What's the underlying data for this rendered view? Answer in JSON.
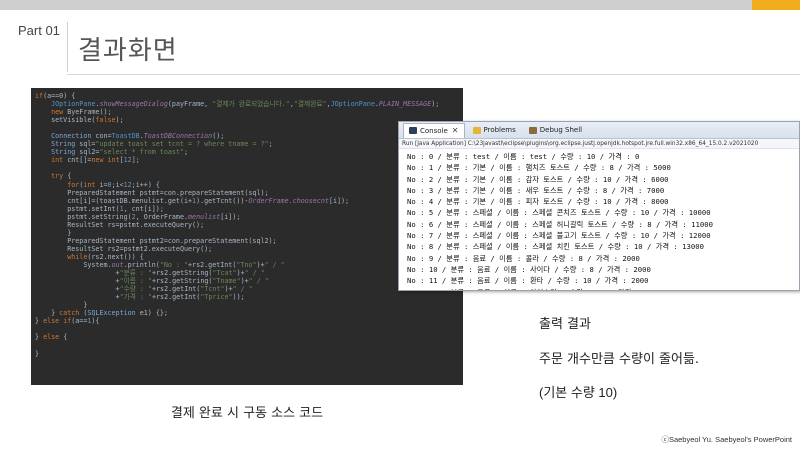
{
  "header": {
    "part_label": "Part 01",
    "title": "결과화면"
  },
  "code": {
    "lines": [
      [
        {
          "c": "kw",
          "t": "if"
        },
        {
          "c": "fn",
          "t": "(a==0) {"
        }
      ],
      [
        {
          "c": "fn",
          "t": "    "
        },
        {
          "c": "cls",
          "t": "JOptionPane"
        },
        {
          "c": "fn",
          "t": "."
        },
        {
          "c": "it",
          "t": "showMessageDialog"
        },
        {
          "c": "fn",
          "t": "(payFrame, "
        },
        {
          "c": "str",
          "t": "\"결제가 완료되었습니다.\""
        },
        {
          "c": "fn",
          "t": ","
        },
        {
          "c": "str",
          "t": "\"결제완료\""
        },
        {
          "c": "fn",
          "t": ","
        },
        {
          "c": "cls",
          "t": "JOptionPane"
        },
        {
          "c": "fn",
          "t": "."
        },
        {
          "c": "it",
          "t": "PLAIN_MESSAGE"
        },
        {
          "c": "fn",
          "t": ");"
        }
      ],
      [
        {
          "c": "fn",
          "t": "    "
        },
        {
          "c": "kw",
          "t": "new"
        },
        {
          "c": "fn",
          "t": " ByeFrame();"
        }
      ],
      [
        {
          "c": "fn",
          "t": "    setVisible("
        },
        {
          "c": "kw",
          "t": "false"
        },
        {
          "c": "fn",
          "t": ");"
        }
      ],
      [
        {
          "c": "fn",
          "t": ""
        }
      ],
      [
        {
          "c": "fn",
          "t": "    "
        },
        {
          "c": "typ",
          "t": "Connection"
        },
        {
          "c": "fn",
          "t": " con="
        },
        {
          "c": "cls",
          "t": "ToastDB"
        },
        {
          "c": "fn",
          "t": "."
        },
        {
          "c": "it",
          "t": "ToastDBConnection"
        },
        {
          "c": "fn",
          "t": "();"
        }
      ],
      [
        {
          "c": "fn",
          "t": "    "
        },
        {
          "c": "typ",
          "t": "String"
        },
        {
          "c": "fn",
          "t": " sql="
        },
        {
          "c": "str",
          "t": "\"update toast set tcnt = ? where tname = ?\""
        },
        {
          "c": "fn",
          "t": ";"
        }
      ],
      [
        {
          "c": "fn",
          "t": "    "
        },
        {
          "c": "typ",
          "t": "String"
        },
        {
          "c": "fn",
          "t": " sql2="
        },
        {
          "c": "str",
          "t": "\"select * from toast\""
        },
        {
          "c": "fn",
          "t": ";"
        }
      ],
      [
        {
          "c": "fn",
          "t": "    "
        },
        {
          "c": "kw",
          "t": "int"
        },
        {
          "c": "fn",
          "t": " cnt[]="
        },
        {
          "c": "kw",
          "t": "new"
        },
        {
          "c": "fn",
          "t": " "
        },
        {
          "c": "kw",
          "t": "int"
        },
        {
          "c": "fn",
          "t": "["
        },
        {
          "c": "num",
          "t": "12"
        },
        {
          "c": "fn",
          "t": "];"
        }
      ],
      [
        {
          "c": "fn",
          "t": ""
        }
      ],
      [
        {
          "c": "fn",
          "t": "    "
        },
        {
          "c": "kw",
          "t": "try"
        },
        {
          "c": "fn",
          "t": " {"
        }
      ],
      [
        {
          "c": "fn",
          "t": "        "
        },
        {
          "c": "kw",
          "t": "for"
        },
        {
          "c": "fn",
          "t": "("
        },
        {
          "c": "kw",
          "t": "int"
        },
        {
          "c": "fn",
          "t": " i="
        },
        {
          "c": "num",
          "t": "0"
        },
        {
          "c": "fn",
          "t": ";i<"
        },
        {
          "c": "num",
          "t": "12"
        },
        {
          "c": "fn",
          "t": ";i++) {"
        }
      ],
      [
        {
          "c": "fn",
          "t": "        PreparedStatement pstmt=con.prepareStatement(sql);"
        }
      ],
      [
        {
          "c": "fn",
          "t": "        cnt[i]=(toastDB.menulist.get(i+"
        },
        {
          "c": "num",
          "t": "1"
        },
        {
          "c": "fn",
          "t": ").getTcnt())-"
        },
        {
          "c": "it",
          "t": "OrderFrame.choosecnt"
        },
        {
          "c": "fn",
          "t": "[i]);"
        }
      ],
      [
        {
          "c": "fn",
          "t": "        pstmt.setInt("
        },
        {
          "c": "num",
          "t": "1"
        },
        {
          "c": "fn",
          "t": ", cnt[i]);"
        }
      ],
      [
        {
          "c": "fn",
          "t": "        pstmt.setString("
        },
        {
          "c": "num",
          "t": "2"
        },
        {
          "c": "fn",
          "t": ", OrderFrame."
        },
        {
          "c": "it",
          "t": "menulist"
        },
        {
          "c": "fn",
          "t": "[i]);"
        }
      ],
      [
        {
          "c": "fn",
          "t": "        ResultSet rs=pstmt.executeQuery();"
        }
      ],
      [
        {
          "c": "fn",
          "t": "        }"
        }
      ],
      [
        {
          "c": "fn",
          "t": "        PreparedStatement pstmt2=con.prepareStatement(sql2);"
        }
      ],
      [
        {
          "c": "fn",
          "t": "        ResultSet rs2=pstmt2.executeQuery();"
        }
      ],
      [
        {
          "c": "fn",
          "t": "        "
        },
        {
          "c": "kw",
          "t": "while"
        },
        {
          "c": "fn",
          "t": "(rs2.next()) {"
        }
      ],
      [
        {
          "c": "fn",
          "t": "            System."
        },
        {
          "c": "it",
          "t": "out"
        },
        {
          "c": "fn",
          "t": ".println("
        },
        {
          "c": "str",
          "t": "\"No : \""
        },
        {
          "c": "fn",
          "t": "+rs2.getInt("
        },
        {
          "c": "str",
          "t": "\"Tno\""
        },
        {
          "c": "fn",
          "t": ")+"
        },
        {
          "c": "str",
          "t": "\" / \""
        }
      ],
      [
        {
          "c": "fn",
          "t": "                    +"
        },
        {
          "c": "str",
          "t": "\"분류 : \""
        },
        {
          "c": "fn",
          "t": "+rs2.getString("
        },
        {
          "c": "str",
          "t": "\"Tcat\""
        },
        {
          "c": "fn",
          "t": ")+"
        },
        {
          "c": "str",
          "t": "\" / \""
        }
      ],
      [
        {
          "c": "fn",
          "t": "                    +"
        },
        {
          "c": "str",
          "t": "\"이름 : \""
        },
        {
          "c": "fn",
          "t": "+rs2.getString("
        },
        {
          "c": "str",
          "t": "\"Tname\""
        },
        {
          "c": "fn",
          "t": ")+"
        },
        {
          "c": "str",
          "t": "\" / \""
        }
      ],
      [
        {
          "c": "fn",
          "t": "                    +"
        },
        {
          "c": "str",
          "t": "\"수량 : \""
        },
        {
          "c": "fn",
          "t": "+rs2.getInt("
        },
        {
          "c": "str",
          "t": "\"Tcnt\""
        },
        {
          "c": "fn",
          "t": ")+"
        },
        {
          "c": "str",
          "t": "\" / \""
        }
      ],
      [
        {
          "c": "fn",
          "t": "                    +"
        },
        {
          "c": "str",
          "t": "\"가격 : \""
        },
        {
          "c": "fn",
          "t": "+rs2.getInt("
        },
        {
          "c": "str",
          "t": "\"Tprice\""
        },
        {
          "c": "fn",
          "t": "));"
        }
      ],
      [
        {
          "c": "fn",
          "t": "            }"
        }
      ],
      [
        {
          "c": "fn",
          "t": "    } "
        },
        {
          "c": "kw",
          "t": "catch"
        },
        {
          "c": "fn",
          "t": " ("
        },
        {
          "c": "typ",
          "t": "SQLException"
        },
        {
          "c": "fn",
          "t": " e1) {};"
        }
      ],
      [
        {
          "c": "fn",
          "t": "} "
        },
        {
          "c": "kw",
          "t": "else if"
        },
        {
          "c": "fn",
          "t": "(a=="
        },
        {
          "c": "num",
          "t": "1"
        },
        {
          "c": "fn",
          "t": "){"
        }
      ],
      [
        {
          "c": "fn",
          "t": ""
        }
      ],
      [
        {
          "c": "fn",
          "t": "} "
        },
        {
          "c": "kw",
          "t": "else"
        },
        {
          "c": "fn",
          "t": " {"
        }
      ],
      [
        {
          "c": "fn",
          "t": ""
        }
      ],
      [
        {
          "c": "fn",
          "t": "}"
        }
      ]
    ]
  },
  "console": {
    "tabs": {
      "console": "Console",
      "problems": "Problems",
      "debug": "Debug Shell",
      "close": "✕"
    },
    "header": "Run [Java Application] C:\\23javastl\\eclipse\\plugins\\org.eclipse.justj.openjdk.hotspot.jre.full.win32.x86_64_15.0.2.v2021020",
    "lines": [
      "No : 0 / 분류 : test / 이름 : test / 수량 : 10 / 가격 : 0",
      "No : 1 / 분류 : 기본 / 이름 : 햄치즈 토스트 / 수량 : 8 / 가격 : 5000",
      "No : 2 / 분류 : 기본 / 이름 : 감자 토스트 / 수량 : 10 / 가격 : 6000",
      "No : 3 / 분류 : 기본 / 이름 : 새우 토스트 / 수량 : 8 / 가격 : 7000",
      "No : 4 / 분류 : 기본 / 이름 : 피자 토스트 / 수량 : 10 / 가격 : 8000",
      "No : 5 / 분류 : 스페셜 / 이름 : 스페셜 콘치즈 토스트 / 수량 : 10 / 가격 : 10000",
      "No : 6 / 분류 : 스페셜 / 이름 : 스페셜 허니갈릭 토스트 / 수량 : 8 / 가격 : 11000",
      "No : 7 / 분류 : 스페셜 / 이름 : 스페셜 불고기 토스트 / 수량 : 10 / 가격 : 12000",
      "No : 8 / 분류 : 스페셜 / 이름 : 스페셜 치킨 토스트 / 수량 : 10 / 가격 : 13000",
      "No : 9 / 분류 : 음료 / 이름 : 콜라 / 수량 : 8 / 가격 : 2000",
      "No : 10 / 분류 : 음료 / 이름 : 사이다 / 수량 : 8 / 가격 : 2000",
      "No : 11 / 분류 : 음료 / 이름 : 환타 / 수량 : 10 / 가격 : 2000",
      "No : 12 / 분류 : 음료 / 이름 : 아이스티 / 수량 : 10 / 가격 : 2000"
    ]
  },
  "captions": {
    "code": "결제 완료 시 구동 소스 코드",
    "result_title": "출력 결과",
    "result_desc1": "주문 개수만큼 수량이 줄어듦.",
    "result_desc2": "(기본 수량 10)"
  },
  "footer": "ⓒSaebyeol Yu. Saebyeol's PowerPoint",
  "colors": {
    "accent": "#f0ad1e",
    "code_bg": "#2b2b2b"
  }
}
